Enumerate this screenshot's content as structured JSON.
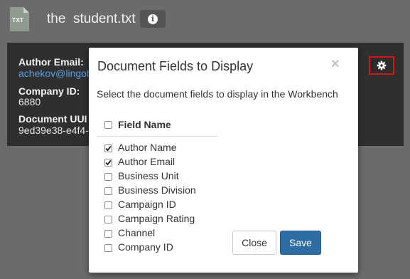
{
  "header": {
    "file_icon_label": "TXT",
    "file_name": "the  student.txt"
  },
  "fields_panel": {
    "author_email_label": "Author Email:",
    "author_email_value": "achekov@lingot",
    "company_id_label": "Company ID:",
    "company_id_value": "6880",
    "document_uuid_label": "Document UUI",
    "document_uuid_value": "9ed39e38-e4f4-"
  },
  "modal": {
    "title": "Document Fields to Display",
    "close_symbol": "×",
    "description": "Select the document fields to display in the Workbench",
    "column_header": "Field Name",
    "select_all_checked": false,
    "fields": [
      {
        "label": "Author Name",
        "checked": true
      },
      {
        "label": "Author Email",
        "checked": true
      },
      {
        "label": "Business Unit",
        "checked": false
      },
      {
        "label": "Business Division",
        "checked": false
      },
      {
        "label": "Campaign ID",
        "checked": false
      },
      {
        "label": "Campaign Rating",
        "checked": false
      },
      {
        "label": "Channel",
        "checked": false
      },
      {
        "label": "Company ID",
        "checked": false
      }
    ],
    "close_button": "Close",
    "save_button": "Save"
  },
  "colors": {
    "background": "#6b6b6b",
    "panel": "#2f2f2f",
    "primary_button": "#2e6da4",
    "link": "#5a9fe0",
    "highlight_border": "#d01818"
  }
}
